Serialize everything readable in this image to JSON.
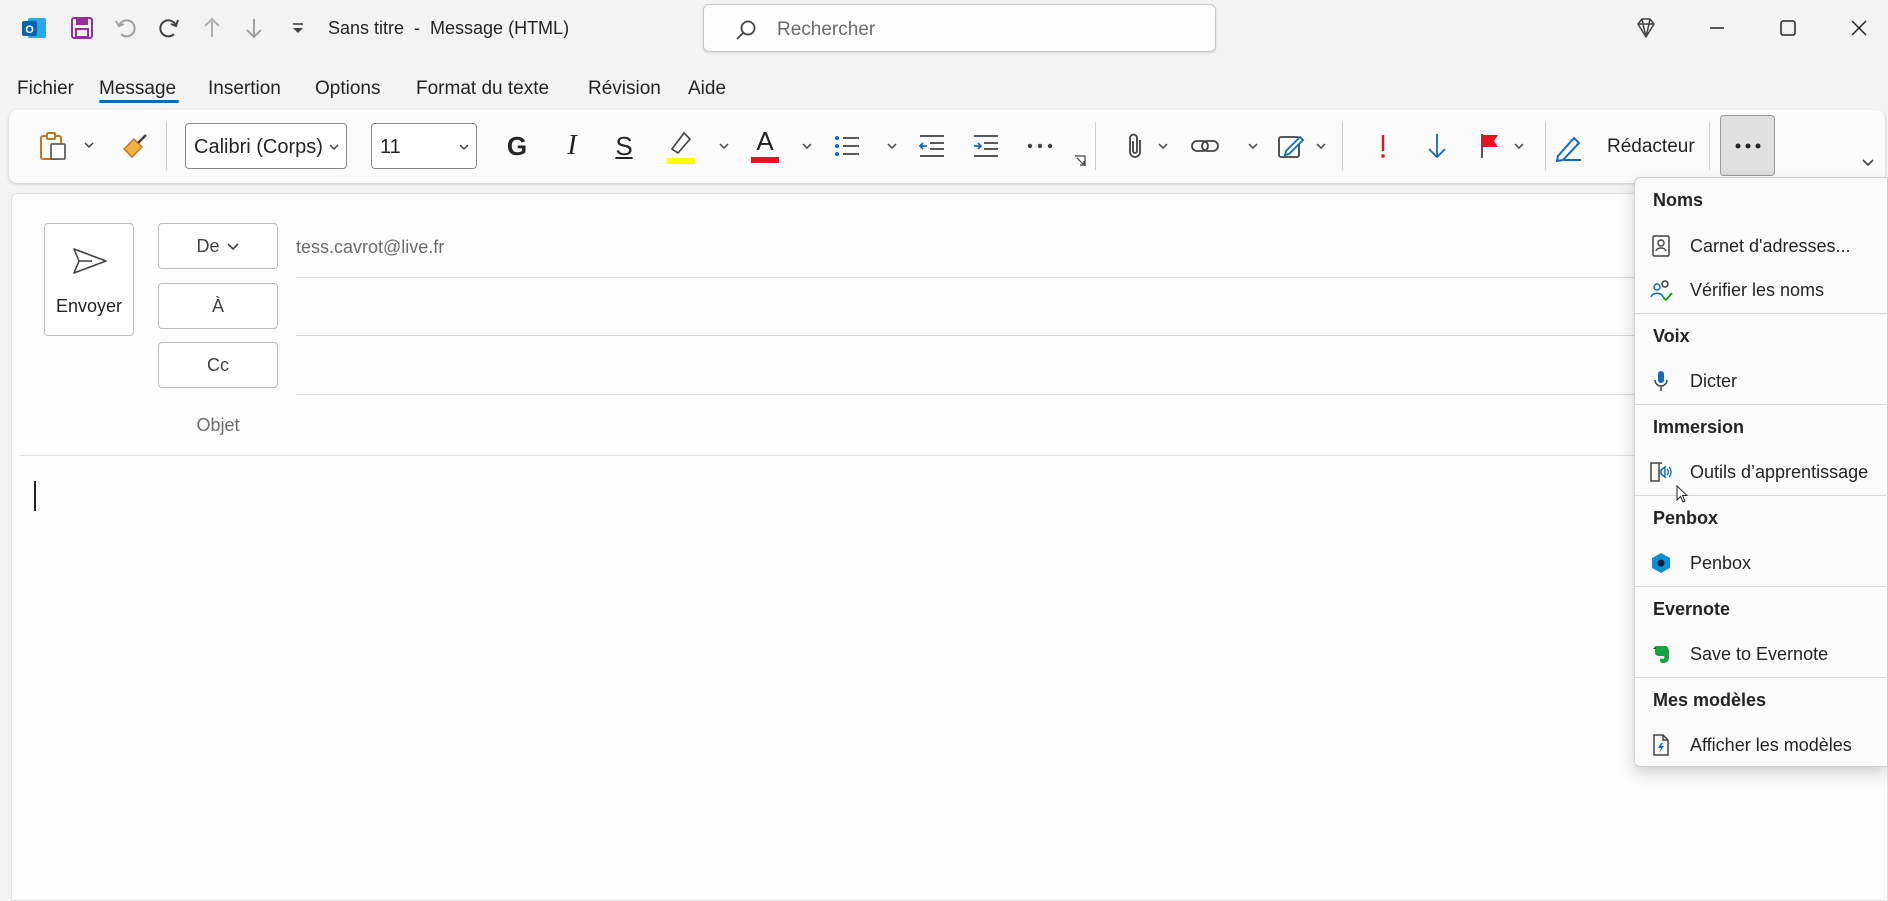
{
  "titlebar": {
    "title": "Sans titre  -  Message (HTML)",
    "search_placeholder": "Rechercher",
    "app_icon": "outlook-icon",
    "quick_access": [
      "save-icon",
      "undo-icon",
      "redo-icon",
      "previous-item-icon",
      "next-item-icon",
      "customize-icon"
    ],
    "window_controls": [
      "premium-icon",
      "minimize-icon",
      "maximize-icon",
      "close-icon"
    ]
  },
  "menu": {
    "tabs": [
      "Fichier",
      "Message",
      "Insertion",
      "Options",
      "Format du texte",
      "Révision",
      "Aide"
    ],
    "active": "Message"
  },
  "ribbon": {
    "font_name": "Calibri (Corps)",
    "font_size": "11",
    "bold_glyph": "G",
    "italic_glyph": "I",
    "strike_glyph": "S",
    "font_color_glyph": "A",
    "redacteur_label": "Rédacteur",
    "highlight_color": "#ffff00",
    "font_color": "#e81123",
    "accent_color": "#0f6cbd"
  },
  "compose": {
    "send_label": "Envoyer",
    "from_label": "De",
    "to_label": "À",
    "cc_label": "Cc",
    "subject_label": "Objet",
    "from_address": "tess.cavrot@live.fr"
  },
  "dropdown": {
    "sections": [
      {
        "heading": "Noms",
        "items": [
          {
            "label": "Carnet d'adresses...",
            "icon": "address-book-icon"
          },
          {
            "label": "Vérifier les noms",
            "icon": "check-names-icon"
          }
        ]
      },
      {
        "heading": "Voix",
        "items": [
          {
            "label": "Dicter",
            "icon": "microphone-icon"
          }
        ]
      },
      {
        "heading": "Immersion",
        "items": [
          {
            "label": "Outils d’apprentissage",
            "icon": "learning-tools-icon"
          }
        ]
      },
      {
        "heading": "Penbox",
        "items": [
          {
            "label": "Penbox",
            "icon": "penbox-icon"
          }
        ]
      },
      {
        "heading": "Evernote",
        "items": [
          {
            "label": "Save to Evernote",
            "icon": "evernote-icon"
          }
        ]
      },
      {
        "heading": "Mes modèles",
        "items": [
          {
            "label": "Afficher les modèles",
            "icon": "templates-icon"
          }
        ]
      }
    ]
  }
}
